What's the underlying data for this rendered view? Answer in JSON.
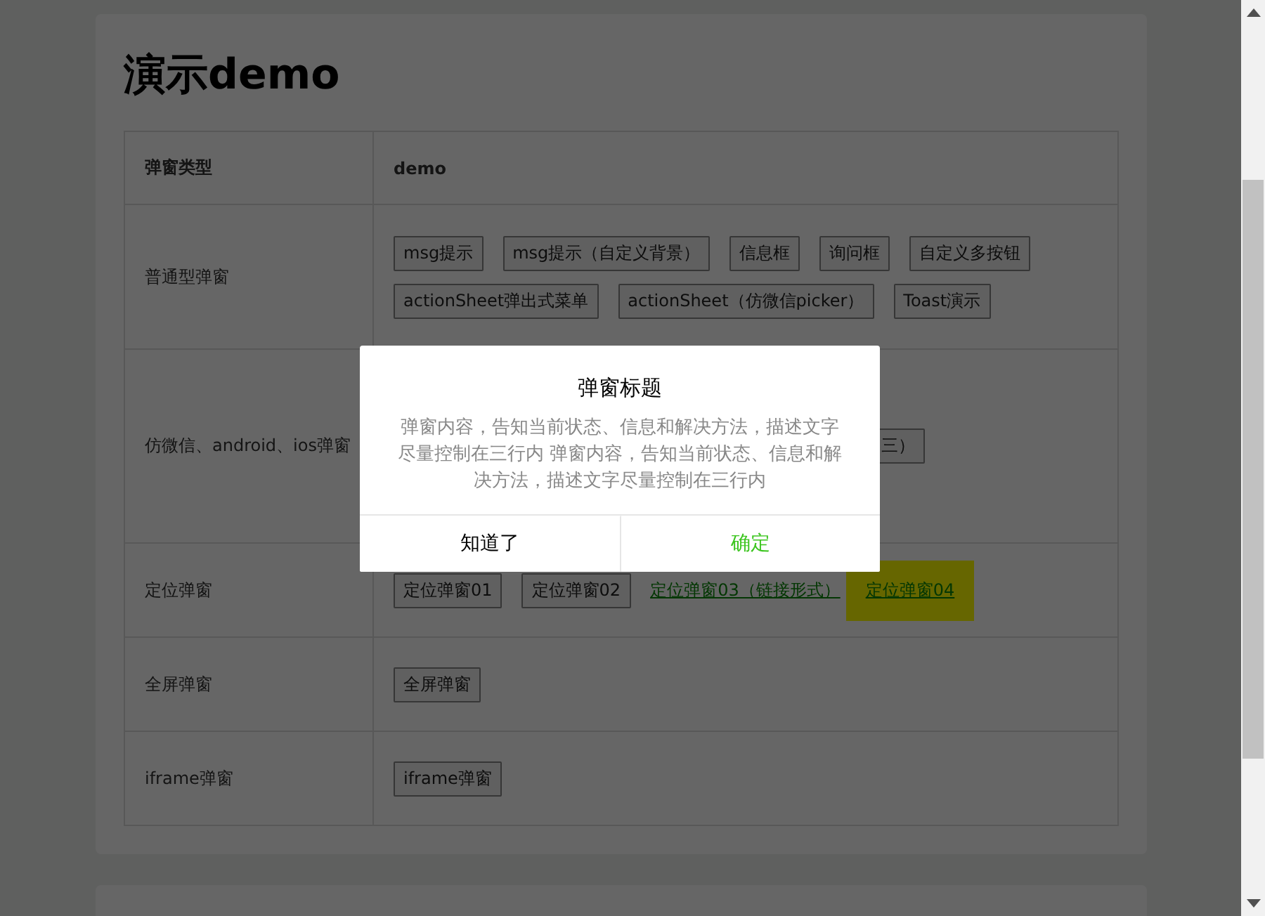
{
  "page_title": "演示demo",
  "table": {
    "columns": [
      "弹窗类型",
      "demo"
    ],
    "rows": [
      {
        "type": "普通型弹窗",
        "items": [
          {
            "label": "msg提示",
            "kind": "button"
          },
          {
            "label": "msg提示（自定义背景）",
            "kind": "button"
          },
          {
            "label": "信息框",
            "kind": "button"
          },
          {
            "label": "询问框",
            "kind": "button"
          },
          {
            "label": "自定义多按钮",
            "kind": "button"
          },
          {
            "label": "actionSheet弹出式菜单",
            "kind": "button"
          },
          {
            "label": "actionSheet（仿微信picker）",
            "kind": "button"
          },
          {
            "label": "Toast演示",
            "kind": "button"
          }
        ]
      },
      {
        "type": "仿微信、android、ios弹窗",
        "items": [
          {
            "label": "三）",
            "kind": "partial"
          }
        ]
      },
      {
        "type": "定位弹窗",
        "items": [
          {
            "label": "定位弹窗01",
            "kind": "button"
          },
          {
            "label": "定位弹窗02",
            "kind": "button"
          },
          {
            "label": "定位弹窗03（链接形式）",
            "kind": "link",
            "highlighted": false
          },
          {
            "label": "定位弹窗04",
            "kind": "link",
            "highlighted": true
          }
        ]
      },
      {
        "type": "全屏弹窗",
        "items": [
          {
            "label": "全屏弹窗",
            "kind": "button"
          }
        ]
      },
      {
        "type": "iframe弹窗",
        "items": [
          {
            "label": "iframe弹窗",
            "kind": "button"
          }
        ]
      }
    ]
  },
  "dialog": {
    "title": "弹窗标题",
    "content": "弹窗内容，告知当前状态、信息和解决方法，描述文字尽量控制在三行内 弹窗内容，告知当前状态、信息和解决方法，描述文字尽量控制在三行内",
    "buttons": [
      {
        "label": "知道了",
        "primary": false
      },
      {
        "label": "确定",
        "primary": true
      }
    ]
  }
}
